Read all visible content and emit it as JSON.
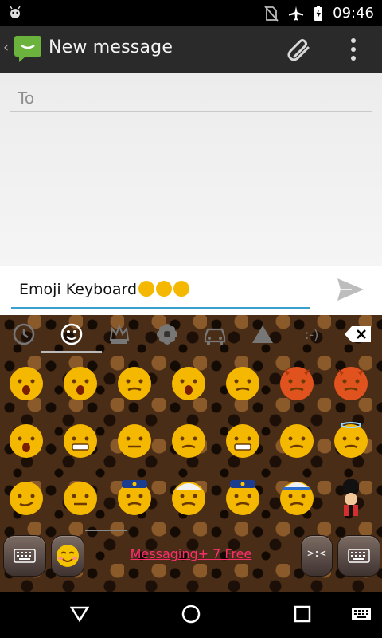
{
  "status_bar": {
    "time": "09:46",
    "icons": [
      "android-debug-icon",
      "no-sim-icon",
      "airplane-icon",
      "battery-icon"
    ]
  },
  "app_bar": {
    "back_icon": "back-chevron-icon",
    "app_icon": "messaging-app-icon",
    "title": "New message",
    "actions": [
      "attach-icon",
      "overflow-menu-icon"
    ]
  },
  "to_field": {
    "placeholder": "To",
    "value": ""
  },
  "compose": {
    "text": "Emoji Keyboard",
    "send_icon": "send-icon"
  },
  "keyboard": {
    "tabs": [
      "recent-clock-icon",
      "smiley-category-icon",
      "crown-category-icon",
      "flower-category-icon",
      "car-category-icon",
      "triangle-category-icon",
      "emoticon-category-icon",
      "backspace-icon"
    ],
    "active_tab": 1,
    "emoji_rows": [
      [
        "dizzy-face-emoji",
        "anguished-face-emoji",
        "frowning-face-emoji",
        "weary-face-emoji",
        "cold-sweat-face-emoji",
        "devil-face-emoji",
        "goblin-face-emoji"
      ],
      [
        "astonished-face-emoji",
        "grimacing-face-emoji",
        "neutral-face-emoji",
        "confused-face-emoji",
        "confounded-face-emoji",
        "blank-face-emoji",
        "angel-face-emoji"
      ],
      [
        "smirk-face-emoji",
        "expressionless-face-emoji",
        "police-officer-emoji",
        "turban-man-emoji",
        "cop-emoji",
        "construction-worker-emoji",
        "guardsman-emoji"
      ]
    ],
    "bottom": {
      "left_key": "keyboard-switch-icon",
      "emoji_key": "emoji-face-icon",
      "promo_text": "Messaging+ 7 Free",
      "right_key_text": ">:<",
      "right_keyboard": "keyboard-icon"
    }
  },
  "nav_bar": [
    "back-triangle-icon",
    "home-circle-icon",
    "recents-square-icon",
    "keyboard-icon"
  ],
  "colors": {
    "appbar": "#2a2a2a",
    "accent": "#3a9fcb",
    "emoji_yellow": "#f5b800",
    "promo": "#ff2f6f",
    "app_green": "#6cb33e"
  }
}
